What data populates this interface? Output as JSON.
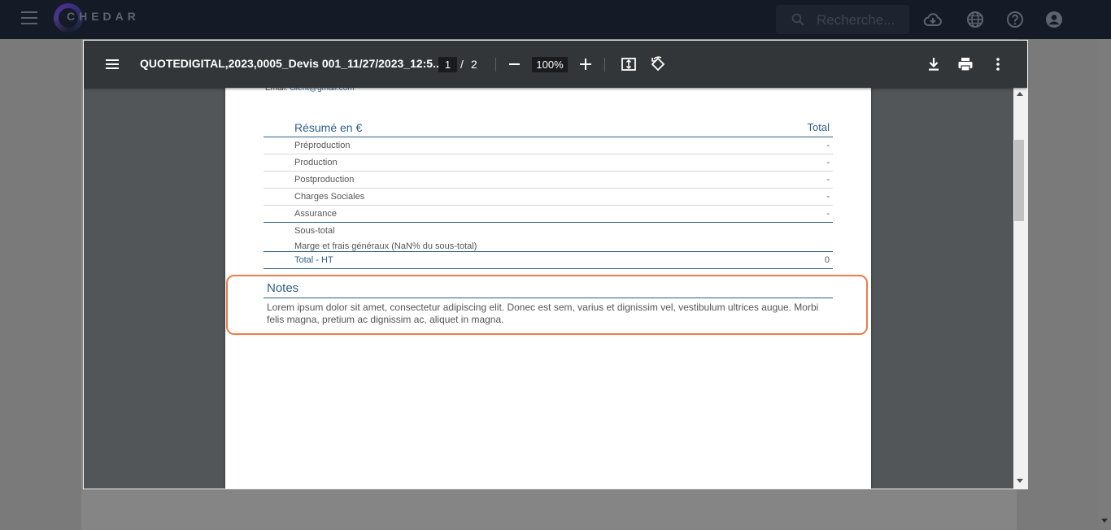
{
  "app": {
    "logo_text": "CHEDAR",
    "search": {
      "placeholder": "Recherche..."
    }
  },
  "pdf_toolbar": {
    "title": "QUOTEDIGITAL,2023,0005_Devis 001_11/27/2023_12:5...",
    "page_current": "1",
    "page_separator": "/",
    "page_total": "2",
    "zoom": "100%"
  },
  "document": {
    "email_label": "Email:",
    "email_value": "client@gmail.com",
    "summary": {
      "title": "Résumé en €",
      "total_header": "Total",
      "rows": [
        {
          "label": "Préproduction",
          "value": "-"
        },
        {
          "label": "Production",
          "value": "-"
        },
        {
          "label": "Postproduction",
          "value": "-"
        },
        {
          "label": "Charges Sociales",
          "value": "-"
        },
        {
          "label": "Assurance",
          "value": "-"
        }
      ],
      "subtotal_label": "Sous-total",
      "margin_label": "Marge et frais généraux (NaN% du sous-total)",
      "total_label": "Total - HT",
      "total_value": "0"
    },
    "notes": {
      "title": "Notes",
      "text": "Lorem ipsum dolor sit amet, consectetur adipiscing elit. Donec est sem, varius et dignissim vel, vestibulum ultrices augue. Morbi felis magna, pretium ac dignissim ac, aliquet in magna."
    }
  },
  "colors": {
    "accent": "#2d5f86",
    "highlight": "#ee7b4a",
    "toolbar": "#323639"
  }
}
